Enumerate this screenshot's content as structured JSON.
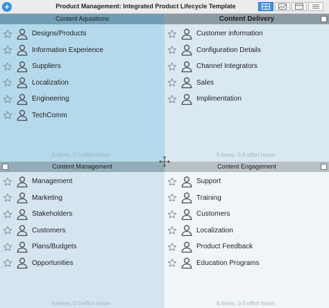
{
  "window": {
    "title": "Product Management: Integrated Product Lifecycle Template",
    "add_label": "+"
  },
  "quadrants": {
    "top_left": {
      "title": "Content Aquisitions",
      "items": [
        "Designs/Products",
        "Information Experience",
        "Suppliers",
        "Localization",
        "Engineering",
        "TechComm"
      ],
      "footer": "6 items, 0.0 effort hours"
    },
    "top_right": {
      "title": "Content Delivery",
      "items": [
        "Customer information",
        "Configuration Details",
        "Channel Integrators",
        "Sales",
        "Implimentation"
      ],
      "footer": "5 items, 0.0 effort hours"
    },
    "bottom_left": {
      "title": "Content Management",
      "items": [
        "Management",
        "Marketing",
        "Stakeholders",
        "Customers",
        "Plans/Budgets",
        "Opportunities"
      ],
      "footer": "6 items, 0.0 effort hours"
    },
    "bottom_right": {
      "title": "Content Engagement",
      "items": [
        "Support",
        "Training",
        "Customers",
        "Localization",
        "Product Feedback",
        "Education Programs"
      ],
      "footer": "6 items, 0.0 effort hours"
    }
  },
  "icons": {
    "item_star": "star-icon",
    "item_person": "person-icon",
    "move": "move-arrows-icon"
  },
  "colors": {
    "accent": "#3d8ef2",
    "q_top_left_bg": "#b3d9ea",
    "q_top_right_bg": "#d9e8f1",
    "q_bottom_left_bg": "#d5e5f0",
    "q_bottom_right_bg": "#f0f6f8"
  }
}
